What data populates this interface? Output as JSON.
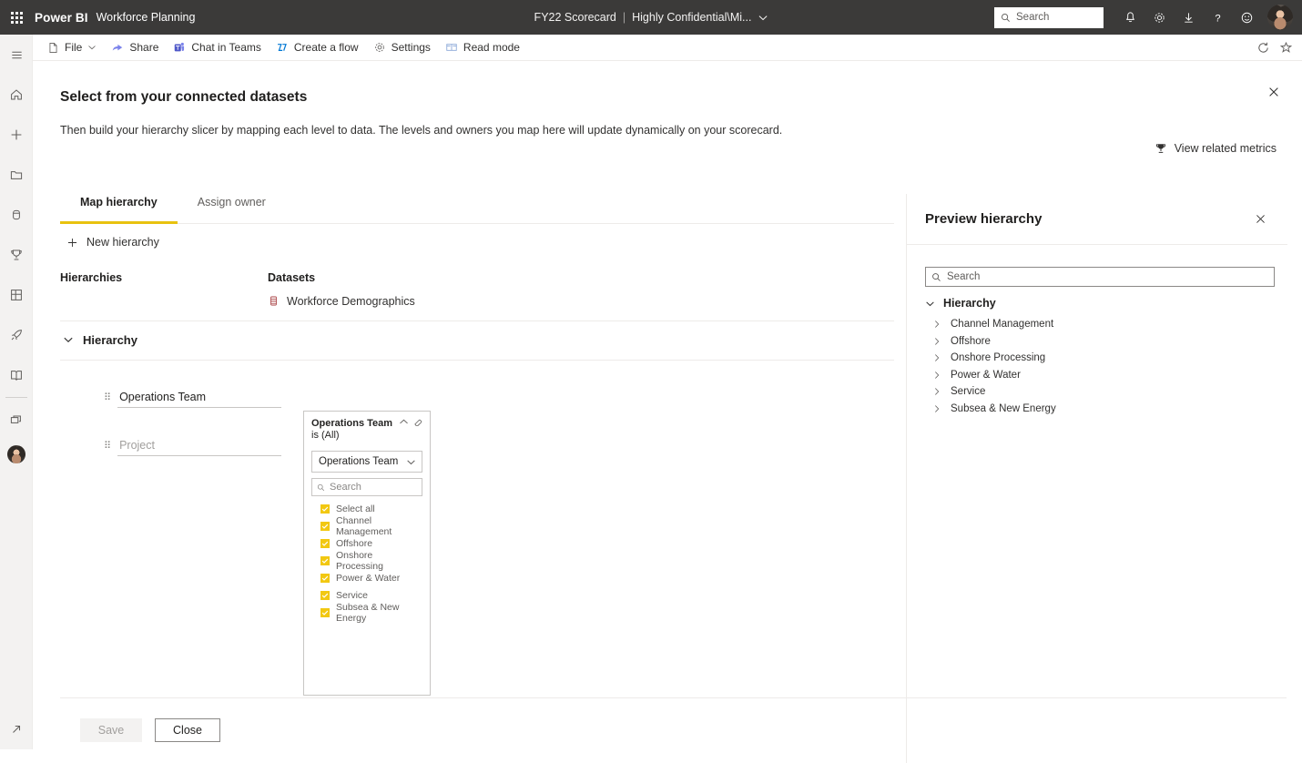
{
  "topbar": {
    "waffle_icon": "waffle-icon",
    "brand": "Power BI",
    "workspace": "Workforce Planning",
    "doc_name": "FY22 Scorecard",
    "doc_separator": "|",
    "sensitivity_label": "Highly Confidential\\Mi...",
    "sensitivity_chevron_icon": "chevron-down-icon",
    "search_placeholder": "Search",
    "icons": [
      "notifications-bell-icon",
      "settings-gear-icon",
      "download-icon",
      "help-question-icon",
      "feedback-smiley-icon"
    ],
    "avatar": "user-avatar"
  },
  "rail": {
    "items": [
      {
        "name": "hamburger-menu-icon",
        "label": "Navigation"
      },
      {
        "name": "home-icon",
        "label": "Home"
      },
      {
        "name": "create-plus-icon",
        "label": "Create"
      },
      {
        "name": "browse-folder-icon",
        "label": "Browse"
      },
      {
        "name": "data-hub-icon",
        "label": "Data hub"
      },
      {
        "name": "goals-trophy-icon",
        "label": "Goals"
      },
      {
        "name": "apps-grid-icon",
        "label": "Apps"
      },
      {
        "name": "deployment-pipelines-rocket-icon",
        "label": "Deployment pipelines"
      },
      {
        "name": "learn-book-icon",
        "label": "Learn"
      },
      {
        "name": "workspaces-icon",
        "label": "Workspaces"
      },
      {
        "name": "my-workspace-avatar",
        "label": "My workspace"
      }
    ],
    "expand_icon": "expand-arrow-icon"
  },
  "commandbar": {
    "items": [
      {
        "name": "file-menu",
        "label": "File",
        "icon": "file-icon",
        "chevron": true
      },
      {
        "name": "share-button",
        "label": "Share",
        "icon": "share-icon"
      },
      {
        "name": "chat-in-teams-button",
        "label": "Chat in Teams",
        "icon": "teams-icon"
      },
      {
        "name": "create-a-flow-button",
        "label": "Create a flow",
        "icon": "power-automate-icon"
      },
      {
        "name": "settings-button",
        "label": "Settings",
        "icon": "gear-icon"
      },
      {
        "name": "read-mode-button",
        "label": "Read mode",
        "icon": "read-mode-icon"
      }
    ],
    "refresh_icon": "refresh-icon",
    "favorite_icon": "favorite-star-icon"
  },
  "dialog": {
    "title": "Select from your connected datasets",
    "subtitle": "Then build your hierarchy slicer by mapping each level to data. The levels and owners you map here will update dynamically on your scorecard.",
    "close_icon": "close-icon",
    "view_related_metrics": "View related metrics",
    "view_related_metrics_icon": "trophy-icon",
    "tabs": [
      {
        "label": "Map hierarchy",
        "active": true
      },
      {
        "label": "Assign owner",
        "active": false
      }
    ],
    "new_hierarchy_label": "New hierarchy",
    "new_hierarchy_icon": "plus-icon",
    "column_headers": {
      "hierarchies": "Hierarchies",
      "datasets": "Datasets"
    },
    "dataset": {
      "name": "Workforce Demographics",
      "icon": "dataset-icon"
    },
    "hierarchy_group": {
      "label": "Hierarchy",
      "chevron_icon": "chevron-down-icon"
    },
    "levels": [
      {
        "value": "Operations Team",
        "placeholder": "",
        "grip_icon": "drag-grip-icon",
        "filled": true
      },
      {
        "value": "",
        "placeholder": "Project",
        "grip_icon": "drag-grip-icon",
        "filled": false
      }
    ],
    "footer": {
      "save_label": "Save",
      "save_disabled": true,
      "close_label": "Close"
    }
  },
  "slicer": {
    "title": "Operations Team",
    "subtitle": "is (All)",
    "collapse_icon": "chevron-up-icon",
    "clear_filter_icon": "eraser-icon",
    "selected_field": "Operations Team",
    "dropdown_icon": "chevron-down-icon",
    "search_placeholder": "Search",
    "search_icon": "search-icon",
    "accent_color": "#f2c811",
    "options": [
      {
        "label": "Select all",
        "checked": true
      },
      {
        "label": "Channel Management",
        "checked": true
      },
      {
        "label": "Offshore",
        "checked": true
      },
      {
        "label": "Onshore Processing",
        "checked": true
      },
      {
        "label": "Power & Water",
        "checked": true
      },
      {
        "label": "Service",
        "checked": true
      },
      {
        "label": "Subsea & New Energy",
        "checked": true
      }
    ]
  },
  "preview": {
    "title": "Preview hierarchy",
    "close_icon": "close-icon",
    "search_placeholder": "Search",
    "search_icon": "search-icon",
    "root": {
      "label": "Hierarchy",
      "chevron_icon": "chevron-down-icon",
      "expanded": true
    },
    "items": [
      {
        "label": "Channel Management",
        "chevron_icon": "chevron-right-icon"
      },
      {
        "label": "Offshore",
        "chevron_icon": "chevron-right-icon"
      },
      {
        "label": "Onshore Processing",
        "chevron_icon": "chevron-right-icon"
      },
      {
        "label": "Power & Water",
        "chevron_icon": "chevron-right-icon"
      },
      {
        "label": "Service",
        "chevron_icon": "chevron-right-icon"
      },
      {
        "label": "Subsea & New Energy",
        "chevron_icon": "chevron-right-icon"
      }
    ]
  },
  "colors": {
    "topbar_bg": "#3b3a39",
    "rail_bg": "#f3f2f1",
    "accent_yellow": "#e8c20f",
    "slicer_check": "#f2c811",
    "text_primary": "#201f1e",
    "text_secondary": "#605e5c",
    "border": "#edebe9"
  }
}
